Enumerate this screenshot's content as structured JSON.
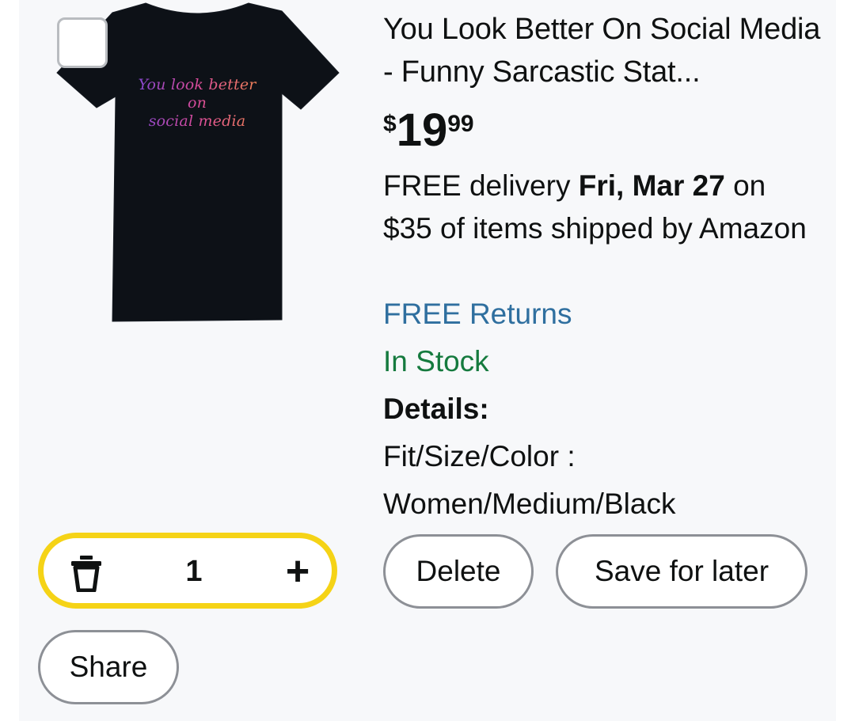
{
  "product": {
    "title": "You Look Better On Social Media - Funny Sarcastic Stat...",
    "image_text_line1": "You look better on",
    "image_text_line2": "social media",
    "price_symbol": "$",
    "price_whole": "19",
    "price_fraction": "99",
    "delivery_prefix": "FREE delivery ",
    "delivery_date": "Fri, Mar 27",
    "delivery_suffix": " on $35 of items shipped by Amazon",
    "returns": "FREE Returns",
    "stock": "In Stock",
    "details_heading": "Details:",
    "fit_label": "Fit/Size/Color :",
    "fit_value": "Women/Medium/Black"
  },
  "controls": {
    "quantity": "1",
    "delete_label": "Delete",
    "save_label": "Save for later",
    "share_label": "Share"
  },
  "colors": {
    "returns_link": "#2f6f9f",
    "in_stock": "#157a3e",
    "stepper_border": "#f5d316"
  },
  "icons": [
    "trash-icon",
    "plus-icon"
  ]
}
